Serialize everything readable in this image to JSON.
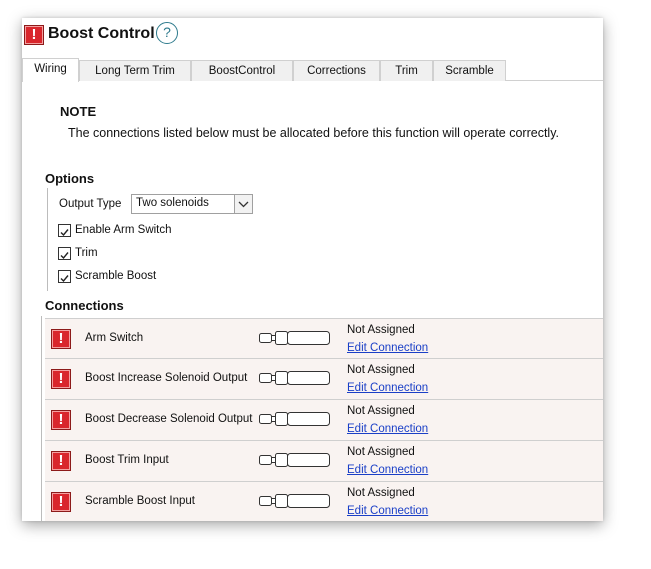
{
  "window": {
    "title": "Boost Control",
    "help_glyph": "?"
  },
  "tabs": [
    {
      "label": "Wiring",
      "active": true
    },
    {
      "label": "Long Term Trim",
      "active": false
    },
    {
      "label": "BoostControl",
      "active": false
    },
    {
      "label": "Corrections",
      "active": false
    },
    {
      "label": "Trim",
      "active": false
    },
    {
      "label": "Scramble",
      "active": false
    }
  ],
  "note": {
    "title": "NOTE",
    "text": "The connections listed below must be allocated before this function will operate correctly."
  },
  "options": {
    "heading": "Options",
    "output_type_label": "Output Type",
    "output_type_value": "Two solenoids",
    "checkboxes": [
      {
        "label": "Enable Arm Switch",
        "checked": true
      },
      {
        "label": "Trim",
        "checked": true
      },
      {
        "label": "Scramble Boost",
        "checked": true
      }
    ]
  },
  "connections": {
    "heading": "Connections",
    "rows": [
      {
        "label": "Arm Switch",
        "status": "Not Assigned",
        "link": "Edit Connection"
      },
      {
        "label": "Boost Increase Solenoid Output",
        "status": "Not Assigned",
        "link": "Edit Connection"
      },
      {
        "label": "Boost Decrease Solenoid Output",
        "status": "Not Assigned",
        "link": "Edit Connection"
      },
      {
        "label": "Boost Trim Input",
        "status": "Not Assigned",
        "link": "Edit Connection"
      },
      {
        "label": "Scramble Boost Input",
        "status": "Not Assigned",
        "link": "Edit Connection"
      }
    ]
  },
  "icons": {
    "warning": "warning-icon",
    "warning_glyph": "!",
    "help": "help-icon",
    "connector": "connector-plug-icon",
    "dropdown": "chevron-down-icon"
  },
  "colors": {
    "warning_red": "#d9262c",
    "link_blue": "#1a3fc7",
    "row_background": "#f9f3f1",
    "help_teal": "#2d7a8c"
  }
}
